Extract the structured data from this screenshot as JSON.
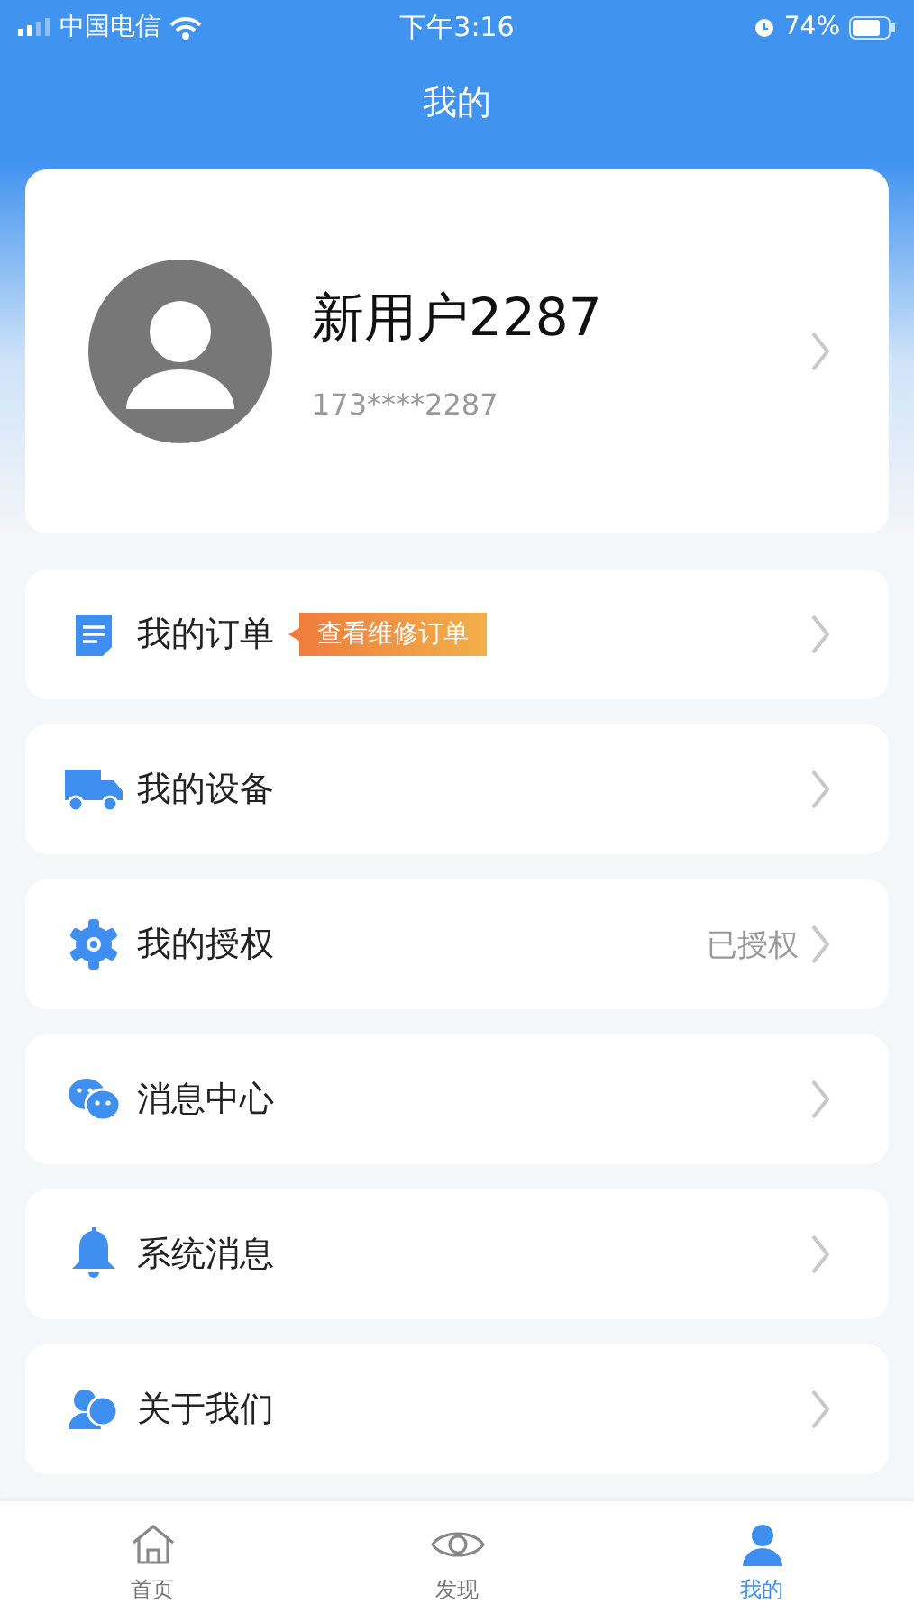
{
  "status_bar": {
    "carrier": "中国电信",
    "time": "下午3:16",
    "battery": "74%"
  },
  "header": {
    "title": "我的"
  },
  "profile": {
    "name": "新用户2287",
    "phone": "173****2287"
  },
  "menu": [
    {
      "kind": "order",
      "label": "我的订单",
      "tag": "查看维修订单"
    },
    {
      "kind": "device",
      "label": "我的设备"
    },
    {
      "kind": "auth",
      "label": "我的授权",
      "value": "已授权"
    },
    {
      "kind": "chat",
      "label": "消息中心"
    },
    {
      "kind": "bell",
      "label": "系统消息"
    },
    {
      "kind": "about",
      "label": "关于我们"
    }
  ],
  "tab_bar": [
    {
      "kind": "home",
      "label": "首页",
      "selected": false
    },
    {
      "kind": "discover",
      "label": "发现",
      "selected": false
    },
    {
      "kind": "me",
      "label": "我的",
      "selected": true
    }
  ]
}
